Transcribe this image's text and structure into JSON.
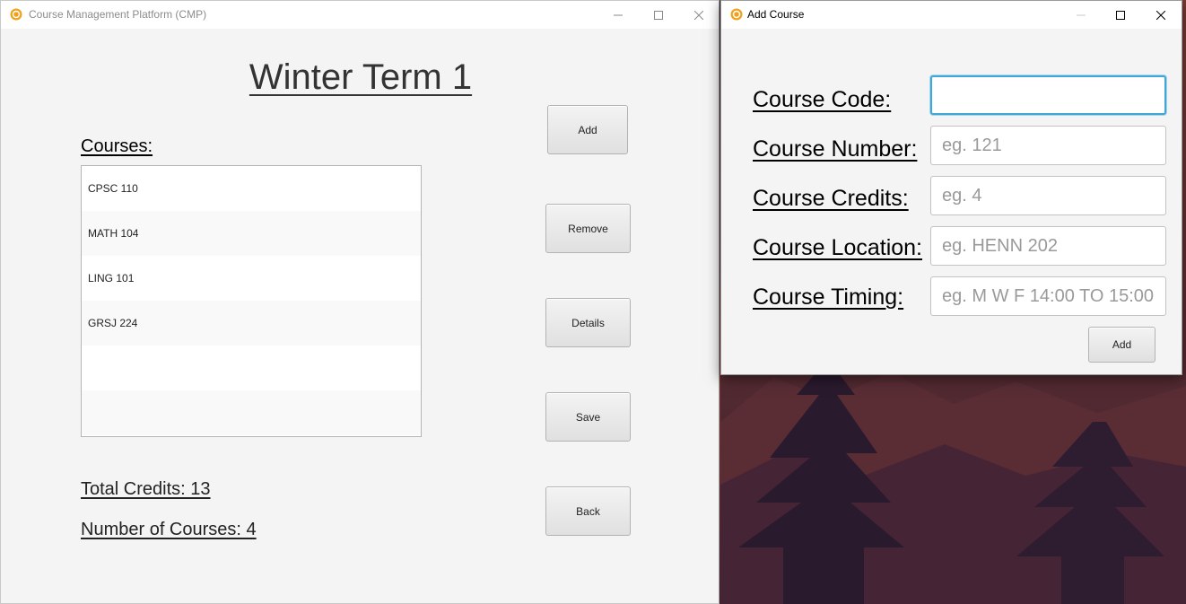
{
  "colors": {
    "focus_ring": "#3fa6d6",
    "app_icon": "#f0a21e",
    "window_bg": "#f4f4f4"
  },
  "main_window": {
    "title": "Course Management Platform (CMP)",
    "icon": "app-logo-icon",
    "term_title": "Winter Term 1",
    "courses_label": "Courses:",
    "courses": [
      "CPSC 110",
      "MATH 104",
      "LING 101",
      "GRSJ 224",
      "",
      ""
    ],
    "buttons": {
      "add": "Add",
      "remove": "Remove",
      "details": "Details",
      "save": "Save",
      "back": "Back"
    },
    "total_credits": "Total Credits: 13",
    "number_of_courses": "Number of Courses: 4"
  },
  "dialog": {
    "title": "Add Course",
    "icon": "app-logo-icon",
    "fields": {
      "code": {
        "label": "Course Code:",
        "value": "",
        "placeholder": ""
      },
      "number": {
        "label": "Course Number:",
        "value": "",
        "placeholder": "eg. 121"
      },
      "credits": {
        "label": "Course Credits:",
        "value": "",
        "placeholder": "eg. 4"
      },
      "location": {
        "label": "Course Location:",
        "value": "",
        "placeholder": "eg. HENN 202"
      },
      "timing": {
        "label": "Course Timing:",
        "value": "",
        "placeholder": "eg. M W F 14:00 TO 15:00"
      }
    },
    "add_button": "Add"
  }
}
